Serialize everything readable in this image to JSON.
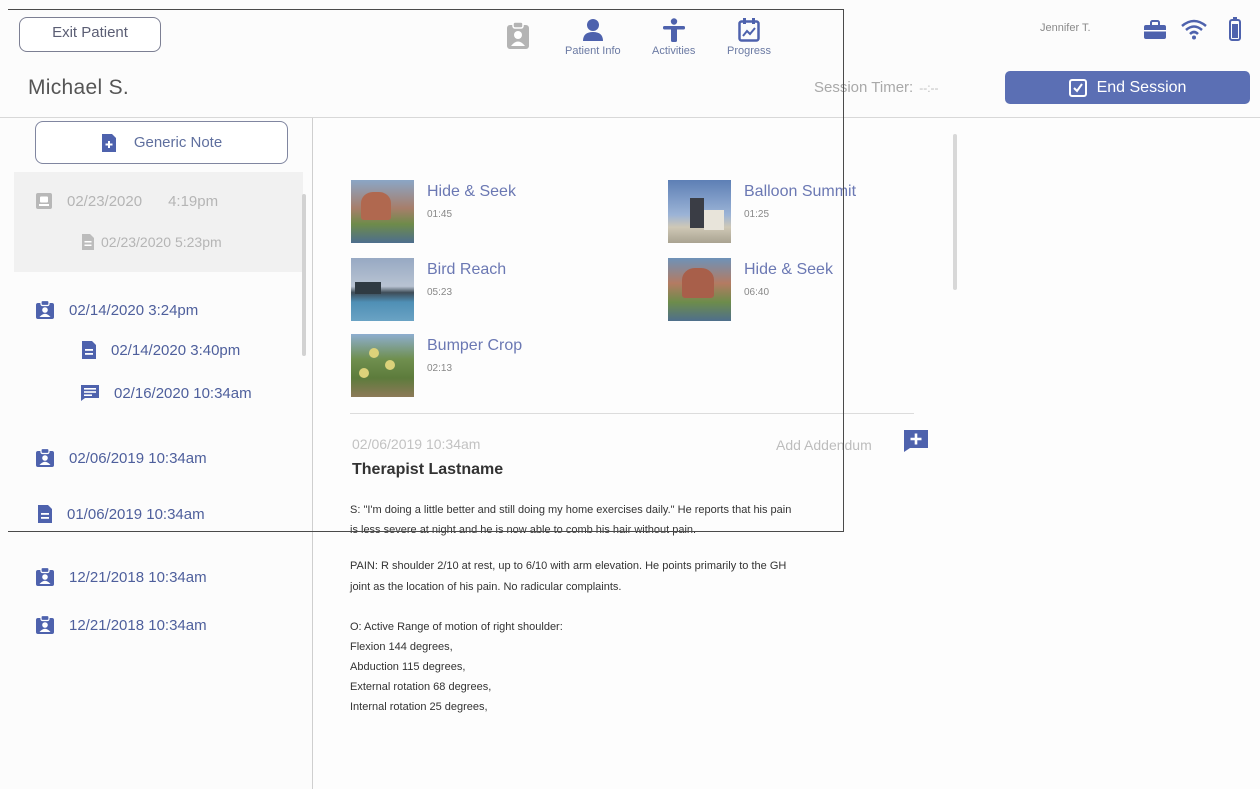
{
  "header": {
    "exit_label": "Exit Patient",
    "patient_name": "Michael S.",
    "user": "Jennifer T.",
    "session_timer_label": "Session Timer:",
    "session_timer_value": "--:--",
    "end_session_label": "End Session",
    "nav": [
      {
        "label": ""
      },
      {
        "label": "Patient Info"
      },
      {
        "label": "Activities"
      },
      {
        "label": "Progress"
      }
    ]
  },
  "sidebar": {
    "generic_note_label": "Generic Note",
    "items": [
      {
        "date": "02/23/2020",
        "time": "4:19pm",
        "icon": "clipboard-icon"
      },
      {
        "text": "02/23/2020 5:23pm",
        "icon": "document-icon"
      },
      {
        "text": "02/14/2020 3:24pm",
        "icon": "clipboard-icon"
      },
      {
        "text": "02/14/2020  3:40pm",
        "icon": "document-icon"
      },
      {
        "text": "02/16/2020 10:34am",
        "icon": "message-icon"
      },
      {
        "text": "02/06/2019 10:34am",
        "icon": "clipboard-icon"
      },
      {
        "text": "01/06/2019 10:34am",
        "icon": "document-icon"
      },
      {
        "text": "12/21/2018 10:34am",
        "icon": "clipboard-icon"
      },
      {
        "text": "12/21/2018 10:34am",
        "icon": "clipboard-icon"
      }
    ]
  },
  "activities": [
    {
      "name": "Hide & Seek",
      "duration": "01:45"
    },
    {
      "name": "Balloon Summit",
      "duration": "01:25"
    },
    {
      "name": "Bird Reach",
      "duration": "05:23"
    },
    {
      "name": "Hide & Seek",
      "duration": "06:40"
    },
    {
      "name": "Bumper Crop",
      "duration": "02:13"
    }
  ],
  "note": {
    "date": "02/06/2019 10:34am",
    "add_addendum": "Add Addendum",
    "therapist": "Therapist Lastname",
    "lines": [
      "S:  \"I'm doing a little better and still doing my home exercises daily.\"  He reports that his pain",
      "is less severe at night and he is now able to comb his hair without pain.",
      "PAIN:  R shoulder 2/10 at rest, up to 6/10 with arm elevation. He points primarily to the GH",
      "joint as the location of his pain. No radicular complaints.",
      "O:  Active Range of motion of right shoulder:",
      "Flexion 144 degrees,",
      "Abduction 115 degrees,",
      "External rotation 68 degrees,",
      "Internal rotation 25 degrees,"
    ]
  },
  "colors": {
    "accent": "#5b6fb4",
    "link": "#6b78b3",
    "icon_blue": "#4e62ad"
  }
}
